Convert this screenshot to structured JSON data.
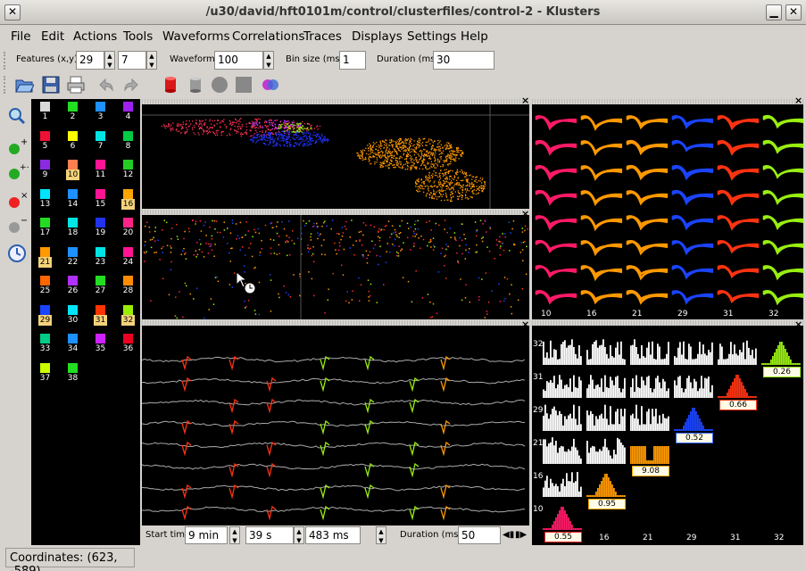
{
  "window": {
    "title": "/u30/david/hft0101m/control/clusterfiles/control-2 - Klusters"
  },
  "menu": [
    "File",
    "Edit",
    "Actions",
    "Tools",
    "Waveforms",
    "Correlations",
    "Traces",
    "Displays",
    "Settings",
    "Help"
  ],
  "toolbar": {
    "features_label": "Features (x,y)",
    "feature_x": "29",
    "feature_y": "7",
    "waveforms_label": "Waveforms",
    "waveforms_value": "100",
    "binsize_label": "Bin size (ms)",
    "binsize_value": "1",
    "duration_label": "Duration (ms)",
    "duration_value": "30"
  },
  "clusters": [
    {
      "n": "1",
      "c": "#d9d9d9"
    },
    {
      "n": "2",
      "c": "#22dd22"
    },
    {
      "n": "3",
      "c": "#1e90ff"
    },
    {
      "n": "4",
      "c": "#a020f0"
    },
    {
      "n": "5",
      "c": "#ee1133"
    },
    {
      "n": "6",
      "c": "#ffff00"
    },
    {
      "n": "7",
      "c": "#00e5e5"
    },
    {
      "n": "8",
      "c": "#00cc44"
    },
    {
      "n": "9",
      "c": "#8a2be2"
    },
    {
      "n": "10",
      "c": "#ff7f50",
      "sel": true
    },
    {
      "n": "11",
      "c": "#ff1493"
    },
    {
      "n": "12",
      "c": "#22cc22"
    },
    {
      "n": "13",
      "c": "#00e5ff"
    },
    {
      "n": "14",
      "c": "#1e90ff"
    },
    {
      "n": "15",
      "c": "#ff1493"
    },
    {
      "n": "16",
      "c": "#ffa500",
      "sel": true
    },
    {
      "n": "17",
      "c": "#22dd22"
    },
    {
      "n": "18",
      "c": "#00e5e5"
    },
    {
      "n": "19",
      "c": "#2233ee"
    },
    {
      "n": "20",
      "c": "#ff2288"
    },
    {
      "n": "21",
      "c": "#ff9900",
      "sel": true
    },
    {
      "n": "22",
      "c": "#1e90ff"
    },
    {
      "n": "23",
      "c": "#00e5e5"
    },
    {
      "n": "24",
      "c": "#ff1493"
    },
    {
      "n": "25",
      "c": "#ff6600"
    },
    {
      "n": "26",
      "c": "#b030ff"
    },
    {
      "n": "27",
      "c": "#22dd22"
    },
    {
      "n": "28",
      "c": "#ff8c00"
    },
    {
      "n": "29",
      "c": "#1a44ff",
      "sel": true
    },
    {
      "n": "30",
      "c": "#00e5ff"
    },
    {
      "n": "31",
      "c": "#ff3300",
      "sel": true
    },
    {
      "n": "32",
      "c": "#99ee00",
      "sel": true
    },
    {
      "n": "33",
      "c": "#00cc88"
    },
    {
      "n": "34",
      "c": "#1e90ff"
    },
    {
      "n": "35",
      "c": "#cc22ff"
    },
    {
      "n": "36",
      "c": "#ee0022"
    },
    {
      "n": "37",
      "c": "#ccff00"
    },
    {
      "n": "38",
      "c": "#22dd22"
    }
  ],
  "waveform_clusters": [
    {
      "label": "10",
      "color": "#ff1a66"
    },
    {
      "label": "16",
      "color": "#ff9900"
    },
    {
      "label": "21",
      "color": "#ff9900"
    },
    {
      "label": "29",
      "color": "#1a44ff"
    },
    {
      "label": "31",
      "color": "#ff3311"
    },
    {
      "label": "32",
      "color": "#99ee11"
    }
  ],
  "correlogram": {
    "row_labels": [
      "32",
      "31",
      "29",
      "21",
      "16",
      "10"
    ],
    "col_labels": [
      "10",
      "16",
      "21",
      "29",
      "31",
      "32"
    ],
    "auto_values": [
      {
        "label": "0.55",
        "color": "#ff1a66",
        "border": "#ff2222"
      },
      {
        "label": "0.95",
        "color": "#ff9900",
        "border": "#ffaa00"
      },
      {
        "label": "9.08",
        "color": "#ff9900",
        "border": "#ffaa00"
      },
      {
        "label": "0.52",
        "color": "#1a44ff",
        "border": "#3366ff"
      },
      {
        "label": "0.66",
        "color": "#ff3311",
        "border": "#ff3311"
      },
      {
        "label": "0.26",
        "color": "#99ee11",
        "border": "#99ee11"
      }
    ]
  },
  "traces": {
    "start_label": "Start time",
    "minutes": "9 min",
    "seconds": "39 s",
    "ms": "483 ms",
    "duration_label": "Duration (ms)",
    "duration_value": "50"
  },
  "status": {
    "coordinates": "Coordinates: (623, -589)"
  },
  "icons": [
    "open-folder-icon",
    "save-icon",
    "print-icon",
    "undo-icon",
    "redo-icon",
    "red-cylinder-icon",
    "grey-cylinder-icon",
    "circle-icon",
    "square-icon",
    "overlap-circles-icon",
    "zoom-icon",
    "add-cluster-icon",
    "add-multi-cluster-icon",
    "delete-cluster-icon",
    "delete-noise-icon",
    "clock-icon"
  ]
}
